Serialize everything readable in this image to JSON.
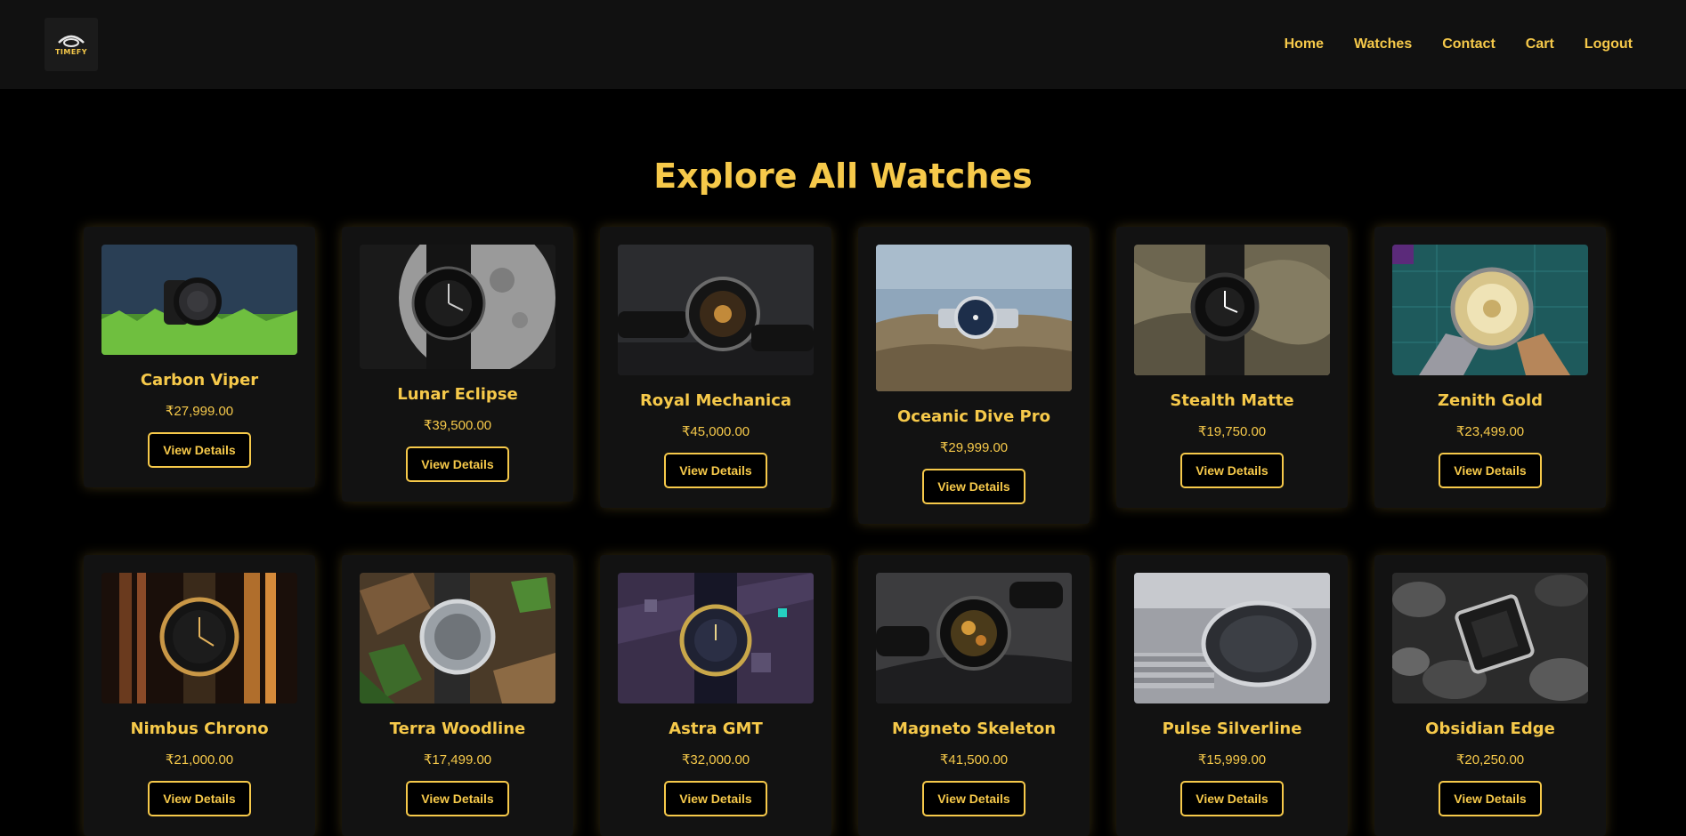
{
  "brand": {
    "logo_text": "TIMEFY",
    "accent": "#f6c94a"
  },
  "nav": {
    "items": [
      "Home",
      "Watches",
      "Contact",
      "Cart",
      "Logout"
    ]
  },
  "page": {
    "title": "Explore All Watches"
  },
  "products": [
    {
      "name": "Carbon Viper",
      "price": "₹27,999.00",
      "button": "View Details"
    },
    {
      "name": "Lunar Eclipse",
      "price": "₹39,500.00",
      "button": "View Details"
    },
    {
      "name": "Royal Mechanica",
      "price": "₹45,000.00",
      "button": "View Details"
    },
    {
      "name": "Oceanic Dive Pro",
      "price": "₹29,999.00",
      "button": "View Details"
    },
    {
      "name": "Stealth Matte",
      "price": "₹19,750.00",
      "button": "View Details"
    },
    {
      "name": "Zenith Gold",
      "price": "₹23,499.00",
      "button": "View Details"
    },
    {
      "name": "Nimbus Chrono",
      "price": "₹21,000.00",
      "button": "View Details"
    },
    {
      "name": "Terra Woodline",
      "price": "₹17,499.00",
      "button": "View Details"
    },
    {
      "name": "Astra GMT",
      "price": "₹32,000.00",
      "button": "View Details"
    },
    {
      "name": "Magneto Skeleton",
      "price": "₹41,500.00",
      "button": "View Details"
    },
    {
      "name": "Pulse Silverline",
      "price": "₹15,999.00",
      "button": "View Details"
    },
    {
      "name": "Obsidian Edge",
      "price": "₹20,250.00",
      "button": "View Details"
    }
  ]
}
